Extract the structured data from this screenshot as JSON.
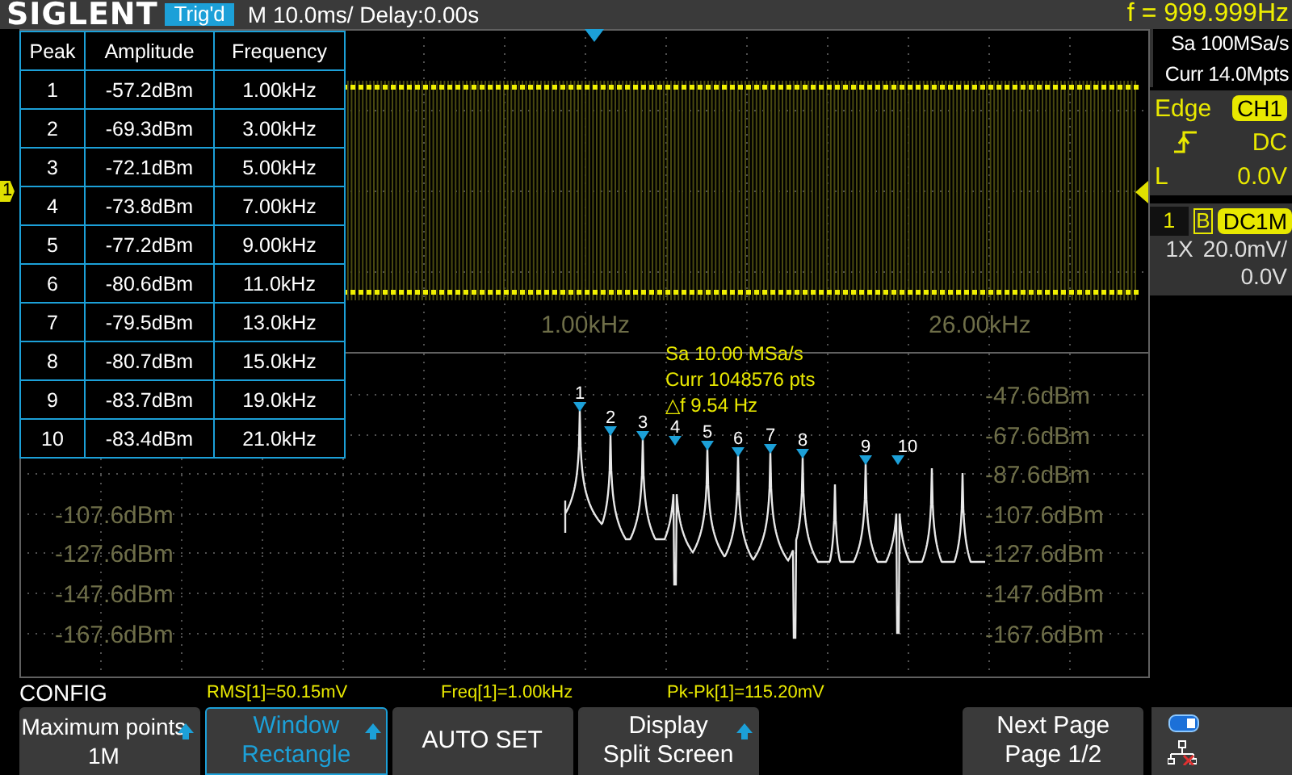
{
  "header": {
    "logo": "SIGLENT",
    "trigger_status": "Trig'd",
    "timebase": "M 10.0ms/ Delay:0.00s",
    "frequency": "f = 999.999Hz"
  },
  "peak_table": {
    "columns": [
      "Peak",
      "Amplitude",
      "Frequency"
    ],
    "rows": [
      [
        "1",
        "-57.2dBm",
        "1.00kHz"
      ],
      [
        "2",
        "-69.3dBm",
        "3.00kHz"
      ],
      [
        "3",
        "-72.1dBm",
        "5.00kHz"
      ],
      [
        "4",
        "-73.8dBm",
        "7.00kHz"
      ],
      [
        "5",
        "-77.2dBm",
        "9.00kHz"
      ],
      [
        "6",
        "-80.6dBm",
        "11.0kHz"
      ],
      [
        "7",
        "-79.5dBm",
        "13.0kHz"
      ],
      [
        "8",
        "-80.7dBm",
        "15.0kHz"
      ],
      [
        "9",
        "-83.7dBm",
        "19.0kHz"
      ],
      [
        "10",
        "-83.4dBm",
        "21.0kHz"
      ]
    ]
  },
  "waveform": {
    "channel_marker": "1"
  },
  "spectrum": {
    "start_freq": "1.00kHz",
    "end_freq": "26.00kHz",
    "info": [
      "Sa 10.00 MSa/s",
      "Curr 1048576 pts",
      "△f 9.54 Hz"
    ],
    "left_scale": [
      "-107.6dBm",
      "-127.6dBm",
      "-147.6dBm",
      "-167.6dBm"
    ],
    "right_scale": [
      "-47.6dBm",
      "-67.6dBm",
      "-87.6dBm",
      "-107.6dBm",
      "-127.6dBm",
      "-147.6dBm",
      "-167.6dBm"
    ],
    "peak_markers": [
      "1",
      "2",
      "3",
      "4",
      "5",
      "6",
      "7",
      "8",
      "9",
      "10"
    ]
  },
  "acquisition": {
    "sample_rate": "Sa 100MSa/s",
    "memory": "Curr 14.0Mpts"
  },
  "trigger": {
    "type": "Edge",
    "source": "CH1",
    "coupling": "DC",
    "level_label": "L",
    "level_reading": "0.0V"
  },
  "channel": {
    "number": "1",
    "bandwidth_limit": "B",
    "coupling": "DC1M",
    "probe": "1X",
    "scale": "20.0mV/",
    "offset": "0.0V"
  },
  "menu_title": "CONFIG",
  "measurements": [
    "RMS[1]=50.15mV",
    "Freq[1]=1.00kHz",
    "Pk-Pk[1]=115.20mV"
  ],
  "softkeys": [
    {
      "kind": "key",
      "label": "Maximum points",
      "value": "1M",
      "selected": false,
      "arrow": true
    },
    {
      "kind": "key",
      "label": "Window",
      "value": "Rectangle",
      "selected": true,
      "arrow": true
    },
    {
      "kind": "key",
      "label": "AUTO SET",
      "selected": false,
      "arrow": false
    },
    {
      "kind": "key",
      "label": "Display",
      "value": "Split Screen",
      "selected": false,
      "arrow": true
    },
    {
      "kind": "blank"
    },
    {
      "kind": "key",
      "label": "Next Page",
      "value": "Page 1/2",
      "selected": false,
      "arrow": false
    }
  ]
}
